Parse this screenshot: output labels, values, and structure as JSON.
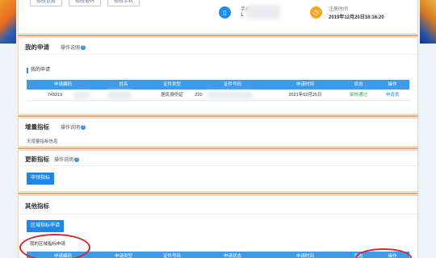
{
  "header": {
    "buttons": [
      {
        "label": "修改信息"
      },
      {
        "label": "修改密码"
      },
      {
        "label": "修改手机"
      }
    ],
    "phone": {
      "label": "手机",
      "value": "1"
    },
    "register": {
      "label": "注册时间",
      "value": "2019年12月20日18:16:20"
    }
  },
  "my_application": {
    "title": "我的申请",
    "help": "操作说明",
    "subheading": "我的申请",
    "columns": [
      "申请编码",
      "姓名",
      "证件类型",
      "证件号码",
      "申请时间",
      "状态",
      "操作"
    ],
    "rows": [
      {
        "code": "743219",
        "name": "",
        "id_type": "居民身份证",
        "id_number": "220",
        "time": "2021年02月25日",
        "status": "审核通过",
        "action": "申请表"
      }
    ]
  },
  "increment": {
    "title": "增量指标",
    "help": "操作说明",
    "empty_text": "无增量指标信息"
  },
  "update": {
    "title": "更新指标",
    "help": "操作说明",
    "button": "申领指标"
  },
  "other": {
    "title": "其他指标",
    "button": "区域指标申请",
    "subheading": "我的区域指标申请",
    "columns": [
      "申请编码",
      "申请类型",
      "证件号码",
      "申请状态",
      "申请时间",
      "状态",
      "操作"
    ]
  },
  "colors": {
    "accent": "#2f8de4",
    "header_blue": "#3d9be9",
    "button_blue": "#1f86e6",
    "status_green": "#3aa845",
    "action_blue": "#2f8de4",
    "annotation_red": "#d8282a",
    "phone_icon": "#1d8cf0",
    "clock_icon": "#f5a623"
  },
  "icons": {
    "phone": "phone-icon",
    "clock": "clock-icon",
    "help": "help-icon"
  }
}
